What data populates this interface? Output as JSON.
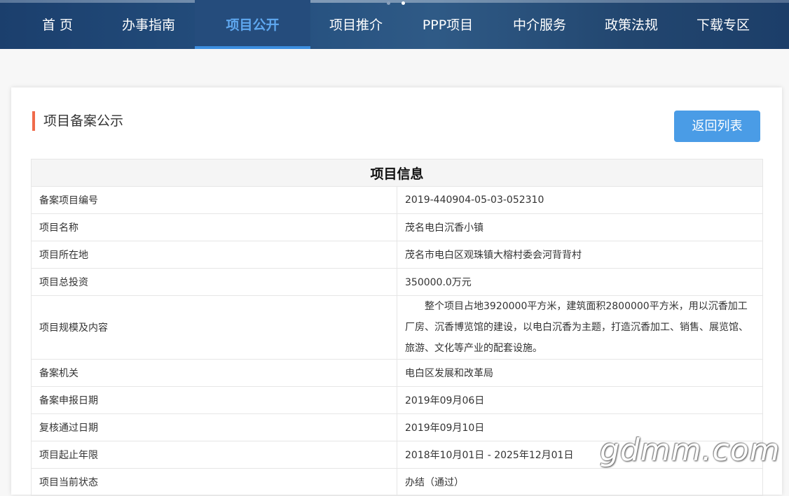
{
  "nav": {
    "items": [
      {
        "label": "首 页"
      },
      {
        "label": "办事指南"
      },
      {
        "label": "项目公开",
        "active": true
      },
      {
        "label": "项目推介"
      },
      {
        "label": "PPP项目"
      },
      {
        "label": "中介服务"
      },
      {
        "label": "政策法规"
      },
      {
        "label": "下载专区"
      }
    ],
    "active_color": "#5fa8f0",
    "bar_color": "#1b3f6d"
  },
  "page": {
    "section_title": "项目备案公示",
    "back_button": "返回列表"
  },
  "table": {
    "header": "项目信息",
    "rows": [
      {
        "label": "备案项目编号",
        "value": "2019-440904-05-03-052310"
      },
      {
        "label": "项目名称",
        "value": "茂名电白沉香小镇"
      },
      {
        "label": "项目所在地",
        "value": "茂名市电白区观珠镇大榕村委会河背背村"
      },
      {
        "label": "项目总投资",
        "value": "350000.0万元"
      },
      {
        "label": "项目规模及内容",
        "value": "整个项目占地3920000平方米，建筑面积2800000平方米，用以沉香加工厂房、沉香博览馆的建设，以电白沉香为主题，打造沉香加工、销售、展览馆、旅游、文化等产业的配套设施。"
      },
      {
        "label": "备案机关",
        "value": "电白区发展和改革局"
      },
      {
        "label": "备案申报日期",
        "value": "2019年09月06日"
      },
      {
        "label": "复核通过日期",
        "value": "2019年09月10日"
      },
      {
        "label": "项目起止年限",
        "value": "2018年10月01日 - 2025年12月01日"
      },
      {
        "label": "项目当前状态",
        "value": "办结（通过）"
      }
    ]
  },
  "watermark": "gdmm.com",
  "colors": {
    "accent": "#4a9ce6",
    "title_marker": "#f06a4a"
  }
}
